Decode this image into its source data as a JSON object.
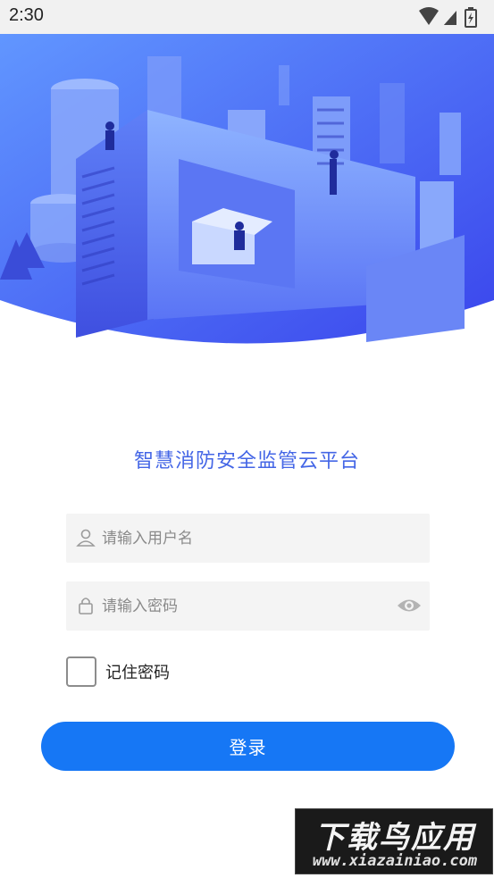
{
  "status_bar": {
    "time": "2:30",
    "icons": [
      "wifi-icon",
      "signal-icon",
      "battery-icon"
    ]
  },
  "app": {
    "title": "智慧消防安全监管云平台"
  },
  "login_form": {
    "username": {
      "value": "",
      "placeholder": "请输入用户名",
      "icon": "user-icon"
    },
    "password": {
      "value": "",
      "placeholder": "请输入密码",
      "icon": "lock-icon",
      "toggle_icon": "eye-icon"
    },
    "remember": {
      "label": "记住密码",
      "checked": false
    },
    "submit_label": "登录"
  },
  "watermark": {
    "main": "下载鸟应用",
    "sub": "www.xiazainiao.com"
  },
  "colors": {
    "accent": "#1677f5",
    "title": "#4466e6",
    "hero_gradient_start": "#5b8cff",
    "hero_gradient_end": "#3a4ef0",
    "field_bg": "#f4f4f4"
  }
}
